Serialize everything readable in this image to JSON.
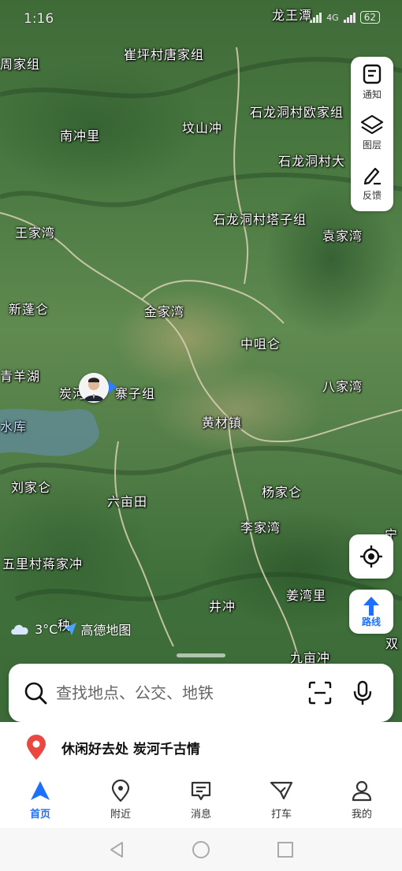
{
  "status_bar": {
    "time": "1:16",
    "network": "4G",
    "battery": "62"
  },
  "map": {
    "labels": [
      {
        "id": "longwangtan",
        "text": "龙王潭"
      },
      {
        "id": "zhoujiazu",
        "text": "周家组"
      },
      {
        "id": "cuipingcun",
        "text": "崔坪村唐家组"
      },
      {
        "id": "nanchongli",
        "text": "南冲里"
      },
      {
        "id": "wenshanchong",
        "text": "坟山冲"
      },
      {
        "id": "shilongdong-ou",
        "text": "石龙洞村欧家组"
      },
      {
        "id": "shilongdong-da",
        "text": "石龙洞村大"
      },
      {
        "id": "shilongdong-ta",
        "text": "石龙洞村塔子组"
      },
      {
        "id": "wangjiawan",
        "text": "王家湾"
      },
      {
        "id": "yuanjiawan",
        "text": "袁家湾"
      },
      {
        "id": "xinpengcang",
        "text": "新蓬仑"
      },
      {
        "id": "jinjiawan",
        "text": "金家湾"
      },
      {
        "id": "zhongjucang",
        "text": "中咀仑"
      },
      {
        "id": "qingyanghu",
        "text": "青羊湖"
      },
      {
        "id": "tanhe",
        "text": "炭河"
      },
      {
        "id": "zhaizizu",
        "text": "寨子组"
      },
      {
        "id": "bajiawan",
        "text": "八家湾"
      },
      {
        "id": "shuiku",
        "text": "水库"
      },
      {
        "id": "huangcaizhen",
        "text": "黄材镇"
      },
      {
        "id": "liujiacang",
        "text": "刘家仑"
      },
      {
        "id": "liumutian",
        "text": "六亩田"
      },
      {
        "id": "yangjiacang",
        "text": "杨家仑"
      },
      {
        "id": "lijiawan",
        "text": "李家湾"
      },
      {
        "id": "ning",
        "text": "宁"
      },
      {
        "id": "wulicun",
        "text": "五里村蒋家冲"
      },
      {
        "id": "jiangwanli",
        "text": "姜湾里"
      },
      {
        "id": "jingchong",
        "text": "井冲"
      },
      {
        "id": "qiu",
        "text": "秧"
      },
      {
        "id": "shuang",
        "text": "双"
      },
      {
        "id": "jiumuchong",
        "text": "九亩冲"
      }
    ]
  },
  "tools": {
    "notify_label": "通知",
    "layers_label": "图层",
    "feedback_label": "反馈",
    "route_label": "路线"
  },
  "weather": {
    "temp": "3°C",
    "brand": "高德地图"
  },
  "search": {
    "placeholder": "查找地点、公交、地铁"
  },
  "recommendation": {
    "text": "休闲好去处 炭河千古情"
  },
  "nav": {
    "home": "首页",
    "nearby": "附近",
    "messages": "消息",
    "taxi": "打车",
    "mine": "我的"
  },
  "colors": {
    "accent": "#1f6fff",
    "pin": "#e9473f"
  }
}
